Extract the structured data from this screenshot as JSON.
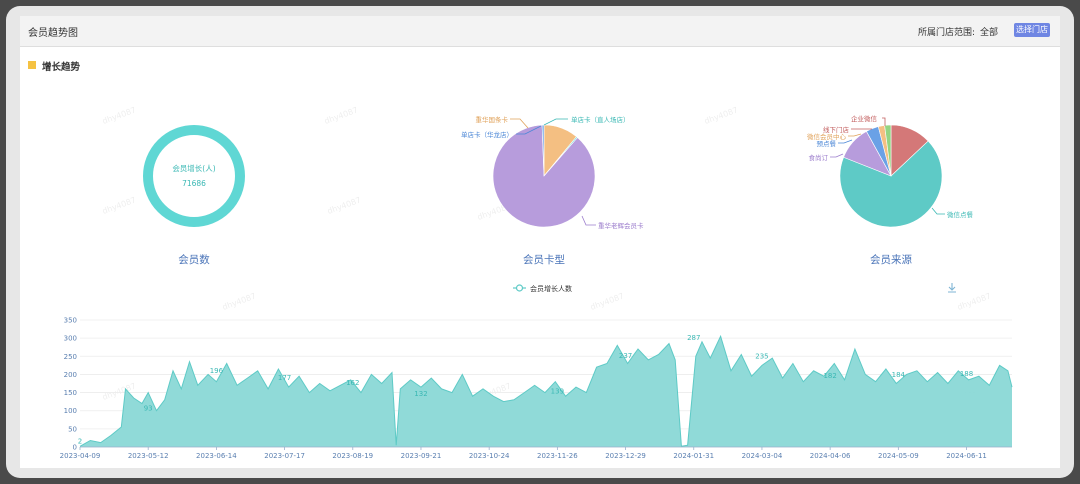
{
  "header": {
    "title": "会员趋势图",
    "scope_label": "所属门店范围:",
    "scope_value": "全部",
    "select_store_button": "选择门店"
  },
  "section": {
    "title": "增长趋势"
  },
  "watermark": "dhy4087",
  "chart_data": [
    {
      "type": "pie",
      "title": "会员数",
      "center_label": "会员增长(人)",
      "center_value": "71686",
      "slices": [
        {
          "label": "会员增长(人)",
          "value": 71686
        }
      ],
      "colors": [
        "#5fd7d4"
      ]
    },
    {
      "type": "pie",
      "title": "会员卡型",
      "slices": [
        {
          "label": "重华国条卡",
          "value": 11
        },
        {
          "label": "单店卡（直人场店）",
          "value": 0.4
        },
        {
          "label": "重华老辉会员卡",
          "value": 88
        },
        {
          "label": "单店卡（华龙店）",
          "value": 0.6
        }
      ],
      "colors": [
        "#f4bf82",
        "#5fd7d4",
        "#b79cdc",
        "#6aa1e6"
      ]
    },
    {
      "type": "pie",
      "title": "会员来源",
      "slices": [
        {
          "label": "企业微信",
          "value": 13
        },
        {
          "label": "微信点餐",
          "value": 68
        },
        {
          "label": "食尚订",
          "value": 11
        },
        {
          "label": "预点餐",
          "value": 4
        },
        {
          "label": "微信会员中心",
          "value": 2
        },
        {
          "label": "线下门店",
          "value": 2
        }
      ],
      "colors": [
        "#d47878",
        "#5ecac6",
        "#b79cdc",
        "#6aa1e6",
        "#f4bf82",
        "#94d482"
      ]
    },
    {
      "type": "area",
      "legend": "会员增长人数",
      "legend_position": "top-center",
      "color": "#5ecac6",
      "ylim": [
        0,
        350
      ],
      "yticks": [
        0,
        50,
        100,
        150,
        200,
        250,
        300,
        350
      ],
      "x_range": [
        "2023-04-09",
        "2024-07-03"
      ],
      "xtick_labels": [
        "2023-04-09",
        "2023-05-12",
        "2023-06-14",
        "2023-07-17",
        "2023-08-19",
        "2023-09-21",
        "2023-10-24",
        "2023-11-26",
        "2023-12-29",
        "2024-01-31",
        "2024-03-04",
        "2024-04-06",
        "2024-05-09",
        "2024-06-11"
      ],
      "grid": true,
      "points": [
        [
          "2023-04-09",
          2
        ],
        [
          "2023-04-14",
          18
        ],
        [
          "2023-04-19",
          12
        ],
        [
          "2023-04-24",
          32
        ],
        [
          "2023-04-29",
          55
        ],
        [
          "2023-05-01",
          160
        ],
        [
          "2023-05-05",
          135
        ],
        [
          "2023-05-09",
          120
        ],
        [
          "2023-05-12",
          150
        ],
        [
          "2023-05-16",
          100
        ],
        [
          "2023-05-20",
          130
        ],
        [
          "2023-05-24",
          210
        ],
        [
          "2023-05-28",
          160
        ],
        [
          "2023-06-01",
          235
        ],
        [
          "2023-06-05",
          170
        ],
        [
          "2023-06-10",
          200
        ],
        [
          "2023-06-14",
          180
        ],
        [
          "2023-06-19",
          230
        ],
        [
          "2023-06-24",
          170
        ],
        [
          "2023-06-29",
          190
        ],
        [
          "2023-07-04",
          210
        ],
        [
          "2023-07-09",
          160
        ],
        [
          "2023-07-14",
          215
        ],
        [
          "2023-07-19",
          165
        ],
        [
          "2023-07-24",
          195
        ],
        [
          "2023-07-29",
          150
        ],
        [
          "2023-08-03",
          175
        ],
        [
          "2023-08-08",
          155
        ],
        [
          "2023-08-13",
          170
        ],
        [
          "2023-08-18",
          185
        ],
        [
          "2023-08-23",
          150
        ],
        [
          "2023-08-28",
          200
        ],
        [
          "2023-09-02",
          175
        ],
        [
          "2023-09-07",
          205
        ],
        [
          "2023-09-09",
          5
        ],
        [
          "2023-09-11",
          160
        ],
        [
          "2023-09-16",
          185
        ],
        [
          "2023-09-21",
          165
        ],
        [
          "2023-09-26",
          190
        ],
        [
          "2023-10-01",
          160
        ],
        [
          "2023-10-06",
          150
        ],
        [
          "2023-10-11",
          200
        ],
        [
          "2023-10-16",
          140
        ],
        [
          "2023-10-21",
          160
        ],
        [
          "2023-10-26",
          140
        ],
        [
          "2023-10-31",
          125
        ],
        [
          "2023-11-05",
          130
        ],
        [
          "2023-11-10",
          150
        ],
        [
          "2023-11-15",
          170
        ],
        [
          "2023-11-20",
          150
        ],
        [
          "2023-11-25",
          180
        ],
        [
          "2023-11-30",
          140
        ],
        [
          "2023-12-05",
          165
        ],
        [
          "2023-12-10",
          150
        ],
        [
          "2023-12-15",
          220
        ],
        [
          "2023-12-20",
          230
        ],
        [
          "2023-12-25",
          280
        ],
        [
          "2023-12-30",
          230
        ],
        [
          "2024-01-04",
          270
        ],
        [
          "2024-01-09",
          240
        ],
        [
          "2024-01-14",
          255
        ],
        [
          "2024-01-19",
          285
        ],
        [
          "2024-01-22",
          240
        ],
        [
          "2024-01-25",
          2
        ],
        [
          "2024-01-28",
          5
        ],
        [
          "2024-02-01",
          250
        ],
        [
          "2024-02-04",
          290
        ],
        [
          "2024-02-08",
          245
        ],
        [
          "2024-02-13",
          305
        ],
        [
          "2024-02-18",
          210
        ],
        [
          "2024-02-23",
          255
        ],
        [
          "2024-02-28",
          195
        ],
        [
          "2024-03-04",
          225
        ],
        [
          "2024-03-09",
          245
        ],
        [
          "2024-03-14",
          190
        ],
        [
          "2024-03-19",
          230
        ],
        [
          "2024-03-24",
          180
        ],
        [
          "2024-03-29",
          210
        ],
        [
          "2024-04-03",
          195
        ],
        [
          "2024-04-08",
          230
        ],
        [
          "2024-04-13",
          185
        ],
        [
          "2024-04-18",
          270
        ],
        [
          "2024-04-23",
          200
        ],
        [
          "2024-04-28",
          180
        ],
        [
          "2024-05-03",
          215
        ],
        [
          "2024-05-08",
          175
        ],
        [
          "2024-05-13",
          200
        ],
        [
          "2024-05-18",
          210
        ],
        [
          "2024-05-23",
          180
        ],
        [
          "2024-05-28",
          205
        ],
        [
          "2024-06-02",
          175
        ],
        [
          "2024-06-07",
          210
        ],
        [
          "2024-06-12",
          185
        ],
        [
          "2024-06-17",
          195
        ],
        [
          "2024-06-22",
          170
        ],
        [
          "2024-06-27",
          225
        ],
        [
          "2024-07-01",
          210
        ],
        [
          "2024-07-03",
          165
        ]
      ],
      "point_labels": [
        {
          "date": "2023-04-09",
          "value": 2
        },
        {
          "date": "2023-05-12",
          "value": 93
        },
        {
          "date": "2023-06-14",
          "value": 196
        },
        {
          "date": "2023-07-17",
          "value": 177
        },
        {
          "date": "2023-08-19",
          "value": 162
        },
        {
          "date": "2023-09-21",
          "value": 132
        },
        {
          "date": "2023-11-26",
          "value": 139
        },
        {
          "date": "2023-12-29",
          "value": 237
        },
        {
          "date": "2024-01-31",
          "value": 287
        },
        {
          "date": "2024-03-04",
          "value": 235
        },
        {
          "date": "2024-04-06",
          "value": 182
        },
        {
          "date": "2024-05-09",
          "value": 184
        },
        {
          "date": "2024-06-11",
          "value": 188
        }
      ]
    }
  ]
}
